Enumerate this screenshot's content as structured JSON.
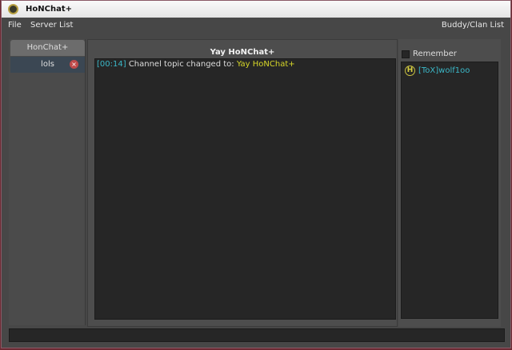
{
  "window": {
    "title": "HoNChat+"
  },
  "menu": {
    "file": "File",
    "server_list": "Server List",
    "buddy_clan_list": "Buddy/Clan List"
  },
  "tabs": [
    {
      "label": "HonChat+"
    },
    {
      "label": "lols",
      "close": "×"
    }
  ],
  "channel": {
    "header": "Yay HoNChat+",
    "messages": [
      {
        "time": "[00:14]",
        "text": "Channel topic changed to:",
        "topic": "Yay HoNChat+"
      }
    ]
  },
  "buddy_panel": {
    "remember_label": "Remember",
    "remember_checked": false,
    "buddies": [
      {
        "badge": "H",
        "name": "[ToX]wolf1oo"
      }
    ]
  },
  "input": {
    "value": ""
  },
  "colors": {
    "timestamp": "#3bb8c8",
    "topic": "#d6d628",
    "background": "#474747"
  }
}
